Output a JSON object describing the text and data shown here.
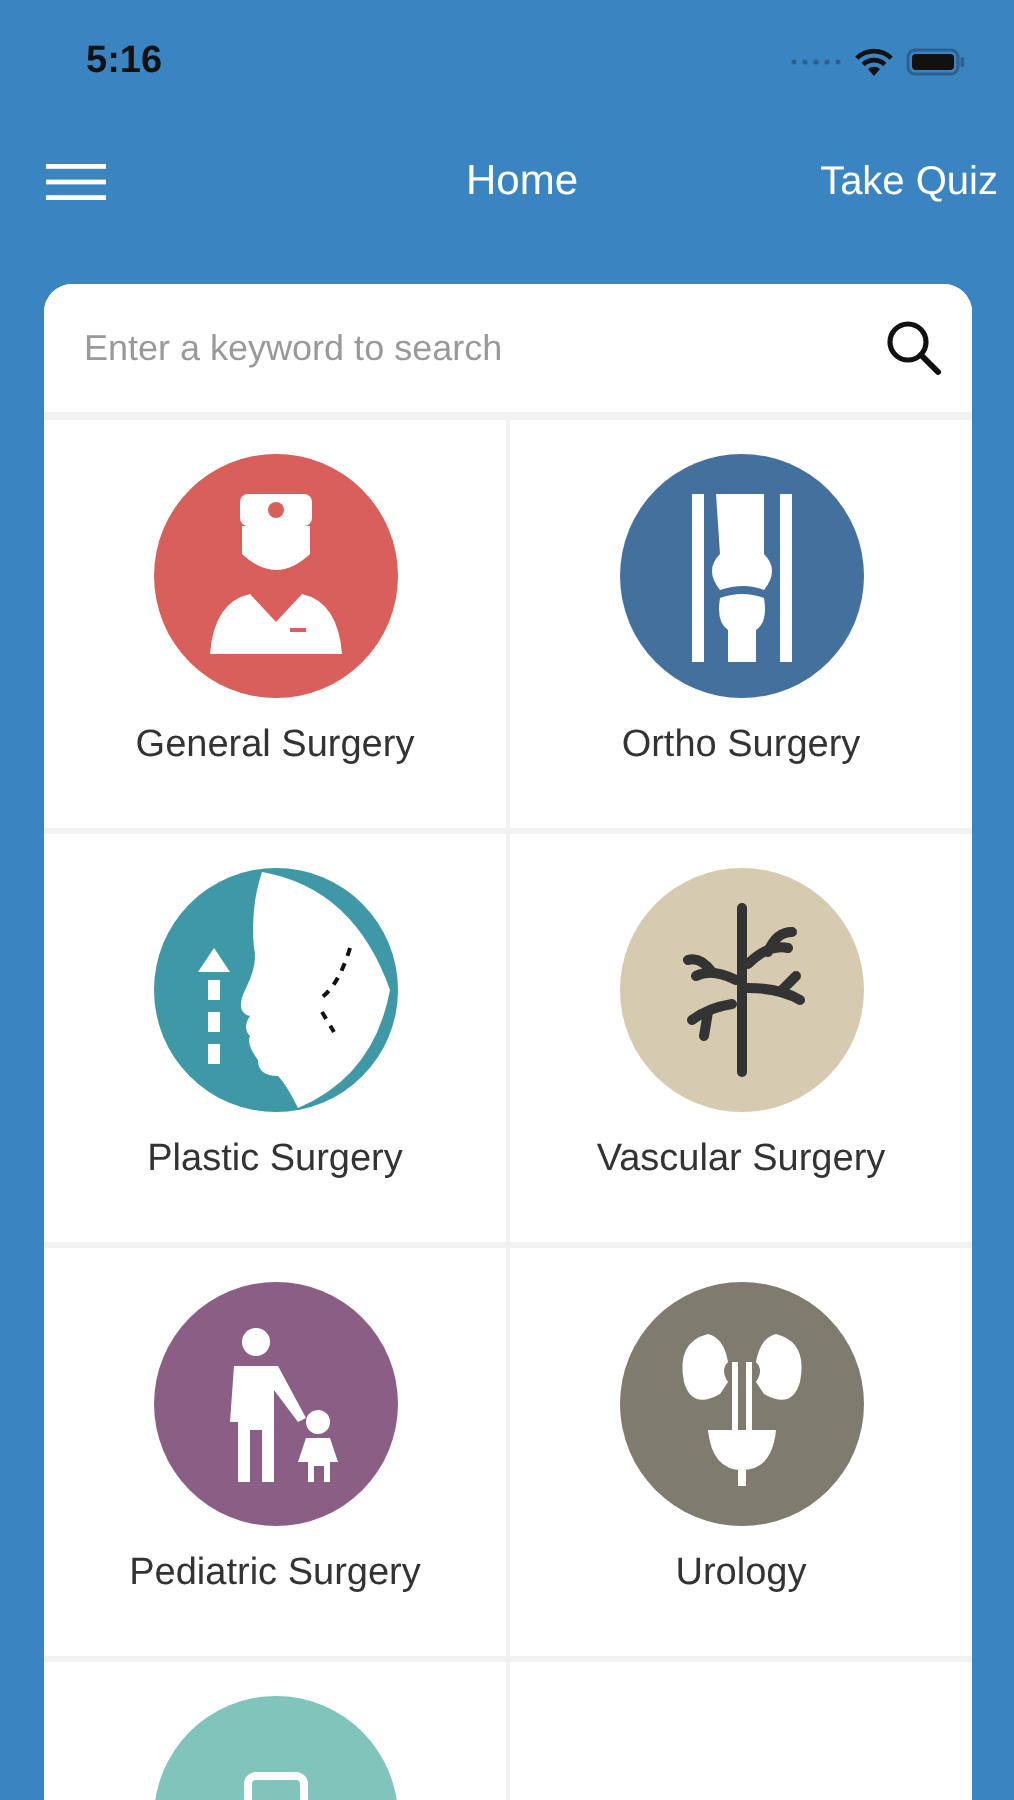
{
  "status_bar": {
    "time": "5:16"
  },
  "nav_bar": {
    "title": "Home",
    "action": "Take Quiz"
  },
  "search": {
    "placeholder": "Enter a keyword to search"
  },
  "categories": [
    {
      "label": "General Surgery",
      "kind": "surgeon",
      "color": "#d9605a"
    },
    {
      "label": "Ortho Surgery",
      "kind": "bone",
      "color": "#43709d"
    },
    {
      "label": "Plastic Surgery",
      "kind": "face",
      "color": "#3f98a6"
    },
    {
      "label": "Vascular Surgery",
      "kind": "vessel",
      "color": "#d6cab0"
    },
    {
      "label": "Pediatric Surgery",
      "kind": "doctor-child",
      "color": "#8b5e86"
    },
    {
      "label": "Urology",
      "kind": "kidney",
      "color": "#7f7b6e"
    },
    {
      "kind": "device",
      "color": "#80c4bc"
    }
  ]
}
